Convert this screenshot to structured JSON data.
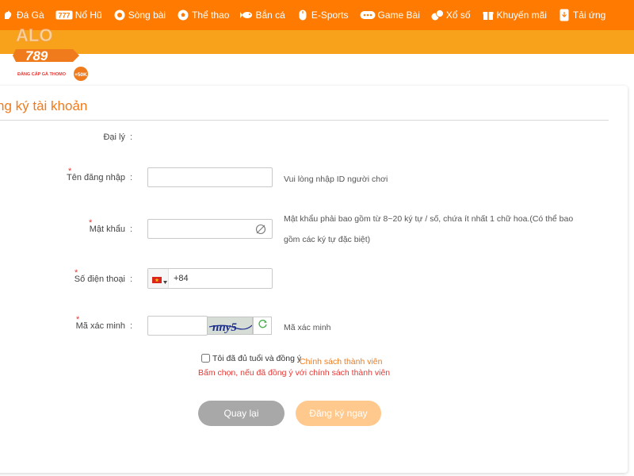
{
  "nav": {
    "items": [
      {
        "label": "Đá Gà",
        "icon": "rooster-icon"
      },
      {
        "label": "Nổ Hũ",
        "icon": "slot-icon"
      },
      {
        "label": "Sòng bài",
        "icon": "poker-chip-icon"
      },
      {
        "label": "Thể thao",
        "icon": "soccer-ball-icon"
      },
      {
        "label": "Bắn cá",
        "icon": "fish-icon"
      },
      {
        "label": "E-Sports",
        "icon": "mouse-icon"
      },
      {
        "label": "Game Bài",
        "icon": "gamepad-icon"
      },
      {
        "label": "Xổ số",
        "icon": "lottery-balls-icon"
      },
      {
        "label": "Khuyến mãi",
        "icon": "gift-icon"
      },
      {
        "label": "Tải ứng",
        "icon": "download-app-icon"
      }
    ]
  },
  "logo": {
    "text_top": "ALO",
    "text_main": "789",
    "tagline": "ĐẲNG CẤP GÀ THOMO",
    "badge": "+50K"
  },
  "page": {
    "title": "ng ký tài khoản"
  },
  "form": {
    "agent": {
      "label": "Đại lý",
      "colon": ":"
    },
    "username": {
      "label": "Tên đăng nhập",
      "colon": ":",
      "required": "*",
      "value": "",
      "hint": "Vui lòng nhập ID người chơi"
    },
    "password": {
      "label": "Mật khẩu",
      "colon": ":",
      "required": "*",
      "value": "",
      "hint_line1": "Mật khẩu phải bao gồm từ 8~20 ký tự / số, chứa ít nhất 1 chữ hoa.(Có thể bao",
      "hint_line2": "gồm các ký tự đặc biệt)"
    },
    "phone": {
      "label": "Số điện thoại",
      "colon": ":",
      "required": "*",
      "value": "+84",
      "country_flag": "vietnam-flag-icon"
    },
    "captcha": {
      "label": "Mã xác minh",
      "colon": ":",
      "required": "*",
      "value": "",
      "image_text": "nny5",
      "hint": "Mã xác minh"
    },
    "agree": {
      "text": "Tôi đã đủ tuổi và đồng ý",
      "link": "Chính sách thành viên",
      "error": "Bấm chọn, nếu đã đồng ý với chính sách thành viên",
      "checked": false
    }
  },
  "buttons": {
    "back": "Quay lại",
    "register": "Đăng ký ngay"
  },
  "colors": {
    "nav": "#ff7a00",
    "stripe": "#f7a21a",
    "accent": "#f07b1c",
    "error": "#e53935",
    "back_btn": "#a8a8a8",
    "register_btn": "#ffc98e"
  }
}
